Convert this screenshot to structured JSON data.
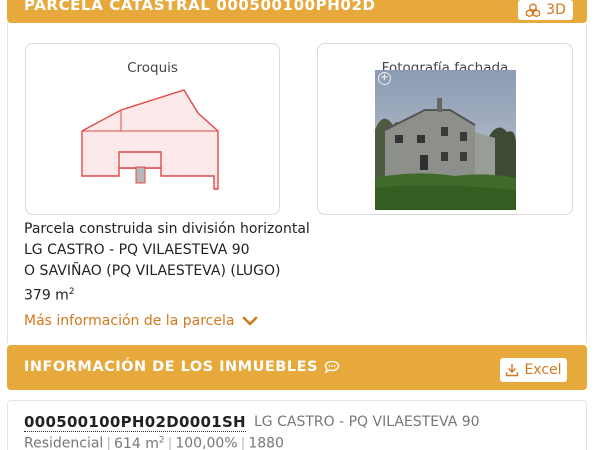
{
  "parcela_header": {
    "title": "PARCELA CATASTRAL 000500100PH02D",
    "btn_3d_label": "3D"
  },
  "croquis": {
    "title": "Croquis"
  },
  "foto": {
    "title": "Fotografía fachada"
  },
  "info": {
    "line1": "Parcela construida sin división horizontal",
    "line2": "LG CASTRO - PQ VILAESTEVA 90",
    "line3": "O SAVIÑAO (PQ VILAESTEVA) (LUGO)",
    "area_value": "379 m",
    "area_exp": "2"
  },
  "more_link": {
    "label": "Más información de la parcela"
  },
  "inmuebles_header": {
    "title": "INFORMACIÓN DE LOS INMUEBLES",
    "excel_label": "Excel"
  },
  "inmueble": {
    "ref": "000500100PH02D0001SH",
    "address": "LG CASTRO - PQ VILAESTEVA 90",
    "use": "Residencial",
    "area": "614 m",
    "area_exp": "2",
    "percent": "100,00%",
    "year": "1880"
  },
  "colors": {
    "accent": "#e8a93c",
    "link": "#d2781f",
    "sketch_stroke": "#e04a4a",
    "sketch_fill": "#fbe9e9"
  }
}
